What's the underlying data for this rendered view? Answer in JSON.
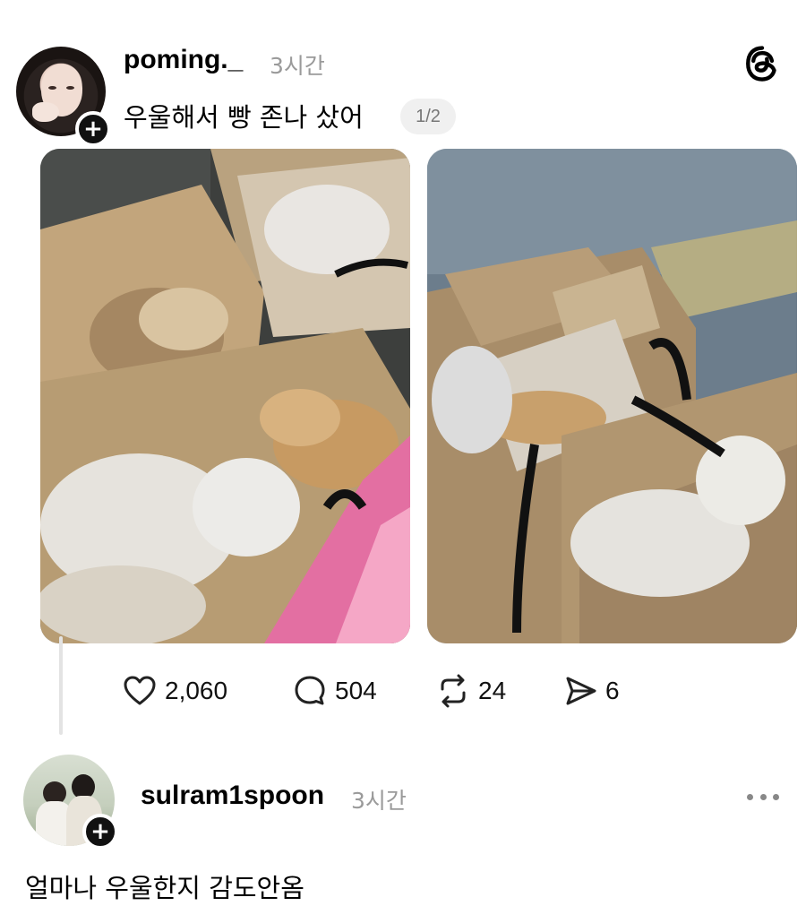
{
  "post": {
    "username": "poming._",
    "time": "3시간",
    "text": "우울해서 빵 존나 샀어",
    "pager": "1/2",
    "follow_symbol": "+",
    "images": [
      {
        "alt": "photo of paper shopping bags filled with bread in plastic bags"
      },
      {
        "alt": "photo of paper shopping bags filled with bread on a sidewalk"
      }
    ],
    "actions": {
      "likes": "2,060",
      "replies": "504",
      "reposts": "24",
      "shares": "6"
    }
  },
  "header": {
    "app_icon": "threads-logo-icon"
  },
  "reply": {
    "username": "sulram1spoon",
    "time": "3시간",
    "text": "얼마나 우울한지 감도안옴",
    "follow_symbol": "+"
  },
  "colors": {
    "text": "#000000",
    "muted": "#9a9a9a",
    "pager_bg": "#f0f0f0",
    "thread_line": "#e3e3e3"
  }
}
